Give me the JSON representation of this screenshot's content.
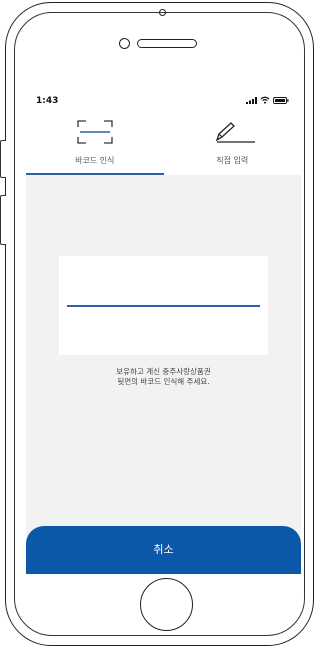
{
  "status_bar": {
    "time": "1:43",
    "icons": [
      "signal-icon",
      "wifi-icon",
      "battery-icon"
    ]
  },
  "tabs": [
    {
      "label": "바코드 인식",
      "icon": "barcode-scan-icon",
      "active": true
    },
    {
      "label": "직접 입력",
      "icon": "pencil-icon",
      "active": false
    }
  ],
  "instructions": {
    "line1": "보유하고 계신 충주사랑상품권",
    "line2": "뒷면의 바코드 인식해 주세요."
  },
  "cancel_label": "취소",
  "colors": {
    "accent": "#2e5fa8",
    "button": "#0b58a8",
    "screen_bg": "#f2f2f2"
  }
}
